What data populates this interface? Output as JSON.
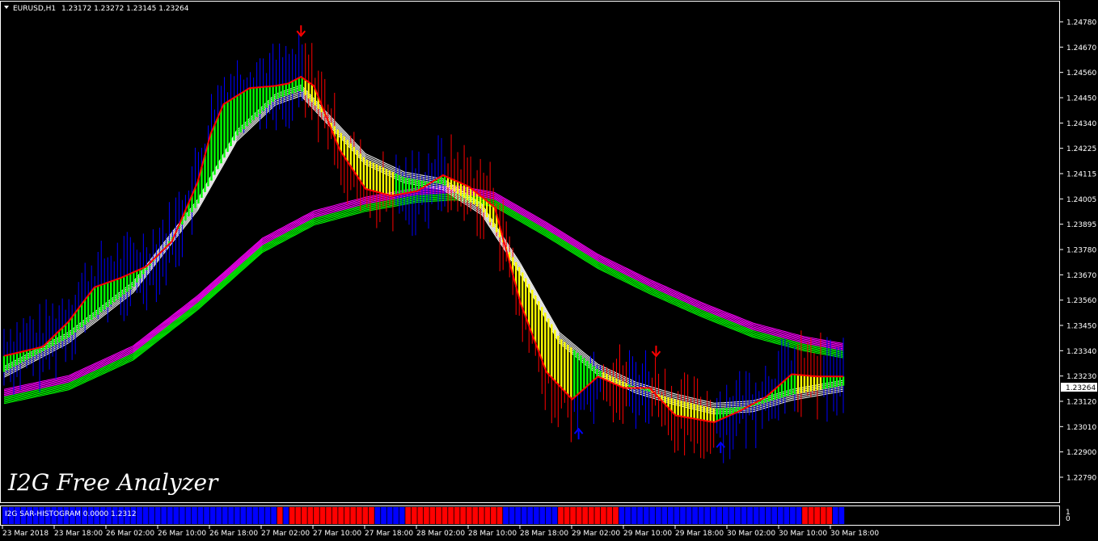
{
  "header": {
    "symbol": "EURUSD,H1",
    "ohlc": "1.23172 1.23272 1.23145 1.23264"
  },
  "watermark": "I2G Free Analyzer",
  "indicator_label": "I2G SAR-HISTOGRAM 0.0000 1.2312",
  "indicator_scale_labels": [
    "1",
    "0"
  ],
  "current_price_label": "1.23264",
  "colors": {
    "background": "#000000",
    "bull_bar": "#0000ff",
    "bear_bar": "#ff0000",
    "bull_body": "#00ff00",
    "bear_body": "#ffff00",
    "fast_line": "#ff0000",
    "ribbon_white": "#ffffff",
    "ribbon_green": "#00ff00",
    "ribbon_magenta": "#ff00ff",
    "hist_up": "#0000ff",
    "hist_down": "#ff0000",
    "arrow_up": "#0000ff",
    "arrow_down": "#ff0000"
  },
  "chart_data": {
    "type": "line",
    "title": "EURUSD,H1",
    "y_ticks": [
      "1.24780",
      "1.24670",
      "1.24560",
      "1.24450",
      "1.24340",
      "1.24225",
      "1.24115",
      "1.24005",
      "1.23895",
      "1.23780",
      "1.23670",
      "1.23560",
      "1.23450",
      "1.23340",
      "1.23230",
      "1.23120",
      "1.23010",
      "1.22900",
      "1.22790"
    ],
    "ylim": [
      1.2279,
      1.2478
    ],
    "x_labels": [
      "23 Mar 2018",
      "23 Mar 18:00",
      "26 Mar 02:00",
      "26 Mar 10:00",
      "26 Mar 18:00",
      "27 Mar 02:00",
      "27 Mar 10:00",
      "27 Mar 18:00",
      "28 Mar 02:00",
      "28 Mar 10:00",
      "28 Mar 18:00",
      "29 Mar 02:00",
      "29 Mar 10:00",
      "29 Mar 18:00",
      "30 Mar 02:00",
      "30 Mar 10:00",
      "30 Mar 18:00"
    ],
    "x_range": [
      0,
      130
    ],
    "series": [
      {
        "role": "fast_ma",
        "points": [
          [
            0,
            1.2332
          ],
          [
            6,
            1.2336
          ],
          [
            10,
            1.2347
          ],
          [
            14,
            1.2362
          ],
          [
            18,
            1.2366
          ],
          [
            22,
            1.2371
          ],
          [
            26,
            1.2382
          ],
          [
            30,
            1.2408
          ],
          [
            32,
            1.2429
          ],
          [
            34,
            1.2442
          ],
          [
            38,
            1.2449
          ],
          [
            42,
            1.245
          ],
          [
            44,
            1.2451
          ],
          [
            46,
            1.2454
          ],
          [
            48,
            1.245
          ],
          [
            52,
            1.2422
          ],
          [
            56,
            1.2405
          ],
          [
            60,
            1.2402
          ],
          [
            64,
            1.2404
          ],
          [
            68,
            1.2411
          ],
          [
            72,
            1.2406
          ],
          [
            76,
            1.2397
          ],
          [
            80,
            1.2355
          ],
          [
            84,
            1.2325
          ],
          [
            88,
            1.2313
          ],
          [
            92,
            1.2323
          ],
          [
            96,
            1.2318
          ],
          [
            100,
            1.2318
          ],
          [
            104,
            1.2306
          ],
          [
            110,
            1.2303
          ],
          [
            114,
            1.2308
          ],
          [
            118,
            1.2314
          ],
          [
            122,
            1.2324
          ],
          [
            126,
            1.2323
          ],
          [
            130,
            1.2323
          ]
        ]
      },
      {
        "role": "white_ribbon",
        "points": [
          [
            0,
            1.2325
          ],
          [
            10,
            1.234
          ],
          [
            20,
            1.2362
          ],
          [
            30,
            1.2398
          ],
          [
            36,
            1.2428
          ],
          [
            42,
            1.2444
          ],
          [
            46,
            1.2448
          ],
          [
            50,
            1.2436
          ],
          [
            56,
            1.2418
          ],
          [
            62,
            1.241
          ],
          [
            68,
            1.2407
          ],
          [
            74,
            1.2396
          ],
          [
            80,
            1.237
          ],
          [
            86,
            1.234
          ],
          [
            92,
            1.2326
          ],
          [
            98,
            1.2318
          ],
          [
            104,
            1.2313
          ],
          [
            110,
            1.2309
          ],
          [
            116,
            1.231
          ],
          [
            122,
            1.2315
          ],
          [
            130,
            1.2319
          ]
        ]
      },
      {
        "role": "green_magenta_ribbon",
        "points": [
          [
            0,
            1.2314
          ],
          [
            10,
            1.232
          ],
          [
            20,
            1.2333
          ],
          [
            30,
            1.2355
          ],
          [
            40,
            1.238
          ],
          [
            48,
            1.2392
          ],
          [
            56,
            1.2398
          ],
          [
            64,
            1.2402
          ],
          [
            70,
            1.2403
          ],
          [
            76,
            1.24
          ],
          [
            84,
            1.2387
          ],
          [
            92,
            1.2373
          ],
          [
            100,
            1.2362
          ],
          [
            108,
            1.2352
          ],
          [
            116,
            1.2343
          ],
          [
            124,
            1.2337
          ],
          [
            130,
            1.2334
          ]
        ]
      }
    ],
    "signals": [
      {
        "type": "sell",
        "x": 46,
        "price": 1.2474
      },
      {
        "type": "buy",
        "x": 89,
        "price": 1.2298
      },
      {
        "type": "sell",
        "x": 101,
        "price": 1.2334
      },
      {
        "type": "buy",
        "x": 111,
        "price": 1.2292
      }
    ],
    "histogram": {
      "labels": [
        "1",
        "0"
      ],
      "states": "UUUUUUUUUUUUUUUUUUUUUUUUUUUUUUUUUUUUUUUUUUUUUDUDDDDDDDDDDDDDDUUUUUDDDDDDDDDDDDDDDDUUUUUUUUUDDDDDDDDDDUUUUUUUUUUUUUUUUUUUUUUUUUUUUUUDDDDDUU"
    }
  }
}
